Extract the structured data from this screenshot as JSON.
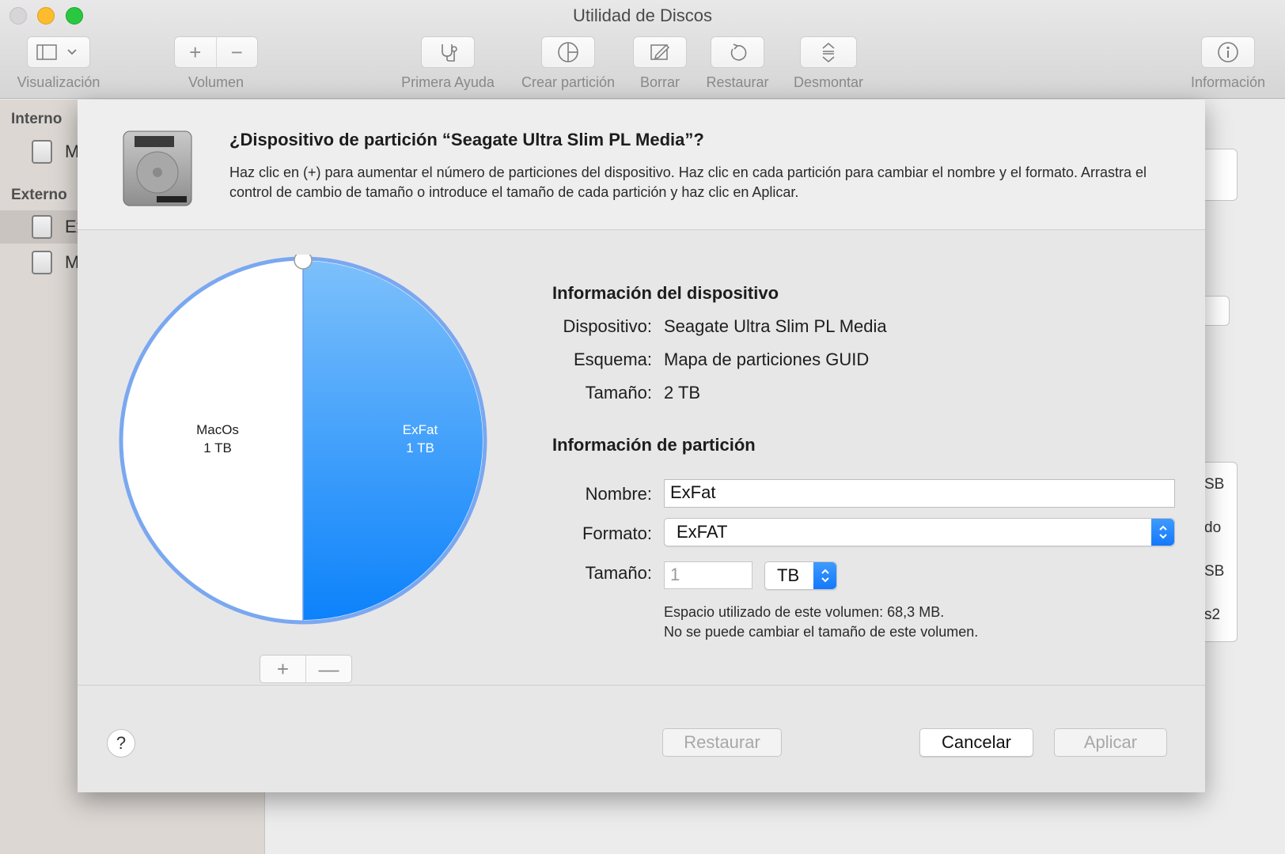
{
  "window": {
    "title": "Utilidad de Discos"
  },
  "toolbar": {
    "view_label": "Visualización",
    "volume_label": "Volumen",
    "first_aid_label": "Primera Ayuda",
    "partition_label": "Crear partición",
    "erase_label": "Borrar",
    "restore_label": "Restaurar",
    "unmount_label": "Desmontar",
    "info_label": "Información"
  },
  "sidebar": {
    "internal_header": "Interno",
    "external_header": "Externo",
    "items": [
      {
        "label": "M"
      },
      {
        "label": "Ex"
      },
      {
        "label": "M"
      }
    ]
  },
  "background_panel": {
    "snippets": [
      "SB",
      "do",
      "SB",
      "s2"
    ]
  },
  "dialog": {
    "title": "¿Dispositivo de partición “Seagate Ultra Slim PL Media”?",
    "description": "Haz clic en (+) para aumentar el número de particiones del dispositivo. Haz clic en cada partición para cambiar el nombre y el formato. Arrastra el control de cambio de tamaño o introduce el tamaño de cada partición y haz clic en Aplicar.",
    "pie": {
      "partitions": [
        {
          "name": "MacOs",
          "size": "1 TB",
          "fraction": 0.5,
          "color": "#ffffff"
        },
        {
          "name": "ExFat",
          "size": "1 TB",
          "fraction": 0.5,
          "color": "#2f9bff"
        }
      ],
      "add_symbol": "+",
      "remove_symbol": "—"
    },
    "device_info": {
      "heading": "Información del dispositivo",
      "device_key": "Dispositivo:",
      "device_val": "Seagate Ultra Slim PL Media",
      "scheme_key": "Esquema:",
      "scheme_val": "Mapa de particiones GUID",
      "size_key": "Tamaño:",
      "size_val": "2 TB"
    },
    "partition_info": {
      "heading": "Información de partición",
      "name_key": "Nombre:",
      "name_value": "ExFat",
      "format_key": "Formato:",
      "format_value": "ExFAT",
      "size_key": "Tamaño:",
      "size_value": "1",
      "size_unit": "TB",
      "used_note": "Espacio utilizado de este volumen: 68,3 MB.",
      "resize_note": "No se puede cambiar el tamaño de este volumen."
    },
    "footer": {
      "help": "?",
      "restore": "Restaurar",
      "cancel": "Cancelar",
      "apply": "Aplicar"
    }
  },
  "colors": {
    "accent_blue": "#1478fb",
    "pie_ring": "#7aa8f0"
  }
}
